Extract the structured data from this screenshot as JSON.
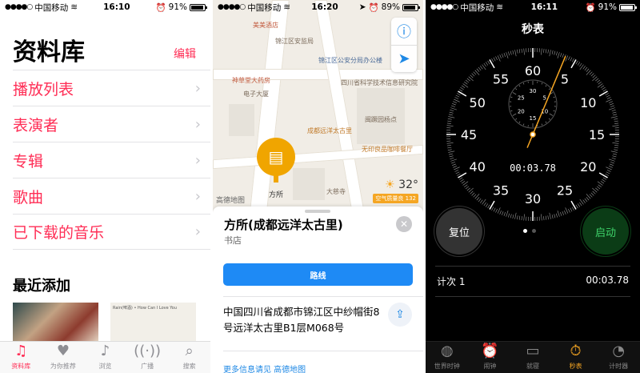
{
  "music": {
    "status": {
      "carrier": "中国移动",
      "time": "16:10",
      "battery": "91%"
    },
    "title": "资料库",
    "edit": "编辑",
    "items": [
      "播放列表",
      "表演者",
      "专辑",
      "歌曲",
      "已下载的音乐"
    ],
    "recent_title": "最近添加",
    "album2_text": "Rain(啤酒) • How Can I Love You",
    "tabs": [
      "资料库",
      "为你推荐",
      "浏览",
      "广播",
      "搜索"
    ]
  },
  "maps": {
    "status": {
      "carrier": "中国移动",
      "time": "16:20",
      "battery": "89%"
    },
    "pois": {
      "meimei": "美美酒店",
      "police_station": "锦江区安监局",
      "police_office": "锦江区公安分局办公楼",
      "pharmacy": "神草堂大药房",
      "electronics": "电子大厦",
      "sichuan_info": "四川省科学技术信息研究院",
      "taikoo": "成都远洋太古里",
      "jinhua": "闽蹶园杨点",
      "muji": "无印良品咖啡餐厅",
      "ciyuan": "大慈寺"
    },
    "pin_label": "方所",
    "temperature": "32°",
    "aqi": "空气质量良 132",
    "logo": "高德地图",
    "place_name": "方所(成都远洋太古里)",
    "place_type": "书店",
    "route_label": "路线",
    "address": "中国四川省成都市锦江区中纱帽街8号远洋太古里B1层M068号",
    "more_info": "更多信息请见 高德地图"
  },
  "stopwatch": {
    "status": {
      "carrier": "中国移动",
      "time": "16:11",
      "battery": "91%"
    },
    "title": "秒表",
    "elapsed": "00:03.78",
    "reset_label": "复位",
    "start_label": "启动",
    "lap_label": "计次 1",
    "lap_time": "00:03.78",
    "outer_numbers": [
      "60",
      "5",
      "10",
      "15",
      "20",
      "25",
      "30",
      "35",
      "40",
      "45",
      "50",
      "55"
    ],
    "inner_numbers": [
      "30",
      "5",
      "10",
      "15",
      "20",
      "25"
    ],
    "seconds_hand": 3.78,
    "tabs": [
      "世界时钟",
      "闹钟",
      "就寝",
      "秒表",
      "计时器"
    ]
  }
}
